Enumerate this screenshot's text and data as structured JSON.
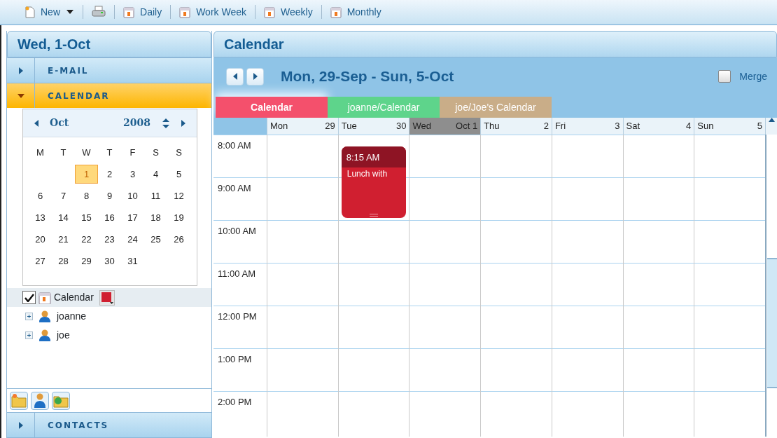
{
  "toolbar": [
    {
      "kind": "new",
      "label": "New",
      "dropdown": true
    },
    {
      "kind": "print"
    },
    {
      "kind": "view",
      "label": "Daily"
    },
    {
      "kind": "view",
      "label": "Work Week"
    },
    {
      "kind": "view",
      "label": "Weekly"
    },
    {
      "kind": "view",
      "label": "Monthly"
    }
  ],
  "sidebar": {
    "date_header": "Wed, 1-Oct",
    "sections": [
      {
        "label": "E-MAIL",
        "expanded": false
      },
      {
        "label": "CALENDAR",
        "expanded": true
      }
    ],
    "mini_calendar": {
      "month": "Oct",
      "year": "2008",
      "weekdays": [
        "M",
        "T",
        "W",
        "T",
        "F",
        "S",
        "S"
      ],
      "weeks": [
        [
          {
            "day": "1",
            "selected": true
          },
          {
            "day": "2",
            "selected": false
          },
          {
            "day": "3",
            "selected": false
          },
          {
            "day": "4",
            "selected": false
          },
          {
            "day": "5",
            "selected": false
          }
        ],
        [
          {
            "day": "6",
            "selected": false
          },
          {
            "day": "7",
            "selected": false
          },
          {
            "day": "8",
            "selected": false
          },
          {
            "day": "9",
            "selected": false
          },
          {
            "day": "10",
            "selected": false
          },
          {
            "day": "11",
            "selected": false
          },
          {
            "day": "12",
            "selected": false
          }
        ],
        [
          {
            "day": "13",
            "selected": false
          },
          {
            "day": "14",
            "selected": false
          },
          {
            "day": "15",
            "selected": false
          },
          {
            "day": "16",
            "selected": false
          },
          {
            "day": "17",
            "selected": false
          },
          {
            "day": "18",
            "selected": false
          },
          {
            "day": "19",
            "selected": false
          }
        ],
        [
          {
            "day": "20",
            "selected": false
          },
          {
            "day": "21",
            "selected": false
          },
          {
            "day": "22",
            "selected": false
          },
          {
            "day": "23",
            "selected": false
          },
          {
            "day": "24",
            "selected": false
          },
          {
            "day": "25",
            "selected": false
          },
          {
            "day": "26",
            "selected": false
          }
        ],
        [
          {
            "day": "27",
            "selected": false
          },
          {
            "day": "28",
            "selected": false
          },
          {
            "day": "29",
            "selected": false
          },
          {
            "day": "30",
            "selected": false
          },
          {
            "day": "31",
            "selected": false
          }
        ]
      ]
    },
    "calendars": [
      {
        "kind": "own",
        "label": "Calendar",
        "checked": true,
        "color": "#d01f30"
      },
      {
        "kind": "user",
        "label": "joanne",
        "expanded": false
      },
      {
        "kind": "user",
        "label": "joe",
        "expanded": false
      }
    ],
    "bottom_section": {
      "label": "CONTACTS",
      "expanded": false
    }
  },
  "main": {
    "title": "Calendar",
    "range": "Mon, 29-Sep - Sun, 5-Oct",
    "merge": {
      "label": "Merge",
      "checked": false
    },
    "tabs": [
      {
        "label": "Calendar",
        "color": "#f4506c",
        "selected": true
      },
      {
        "label": "joanne/Calendar",
        "color": "#5ed48b",
        "selected": false
      },
      {
        "label": "joe/Joe's Calendar",
        "color": "#c9ad88",
        "selected": false
      }
    ],
    "days": [
      {
        "name": "Mon",
        "date": "29",
        "today": false
      },
      {
        "name": "Tue",
        "date": "30",
        "today": false,
        "events": [
          {
            "time": "8:15 AM",
            "title": "Lunch with"
          }
        ]
      },
      {
        "name": "Wed",
        "date": "Oct 1",
        "today": true
      },
      {
        "name": "Thu",
        "date": "2",
        "today": false
      },
      {
        "name": "Fri",
        "date": "3",
        "today": false
      },
      {
        "name": "Sat",
        "date": "4",
        "today": false
      },
      {
        "name": "Sun",
        "date": "5",
        "today": false
      }
    ],
    "times": [
      "8:00 AM",
      "9:00 AM",
      "10:00 AM",
      "11:00 AM",
      "12:00 PM",
      "1:00 PM",
      "2:00 PM"
    ]
  }
}
